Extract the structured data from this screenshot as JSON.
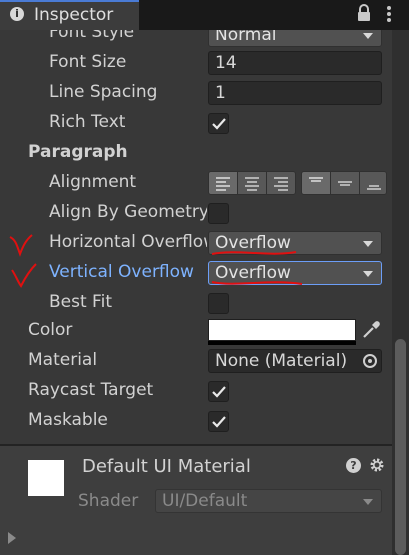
{
  "window": {
    "tab_title": "Inspector"
  },
  "properties": {
    "font_style": {
      "label": "Font Style",
      "value": "Normal"
    },
    "font_size": {
      "label": "Font Size",
      "value": "14"
    },
    "line_spacing": {
      "label": "Line Spacing",
      "value": "1"
    },
    "rich_text": {
      "label": "Rich Text",
      "checked": true
    },
    "paragraph_header": "Paragraph",
    "alignment": {
      "label": "Alignment",
      "horizontal_selected": "left",
      "vertical_selected": "top"
    },
    "align_by_geometry": {
      "label": "Align By Geometry",
      "checked": false
    },
    "horizontal_overflow": {
      "label": "Horizontal Overflow",
      "value": "Overflow"
    },
    "vertical_overflow": {
      "label": "Vertical Overflow",
      "value": "Overflow"
    },
    "best_fit": {
      "label": "Best Fit",
      "checked": false
    },
    "color": {
      "label": "Color",
      "value": "#ffffff"
    },
    "material": {
      "label": "Material",
      "value": "None (Material)"
    },
    "raycast_target": {
      "label": "Raycast Target",
      "checked": true
    },
    "maskable": {
      "label": "Maskable",
      "checked": true
    }
  },
  "material_section": {
    "name": "Default UI Material",
    "shader_label": "Shader",
    "shader_value": "UI/Default",
    "help_glyph": "?"
  },
  "annotations": {
    "color": "#e01010",
    "marks": [
      "checkmark-horizontal-overflow",
      "checkmark-vertical-overflow",
      "underline-overflow-values"
    ]
  },
  "icons": [
    "info-icon",
    "lock-icon",
    "more-options-icon",
    "eyedropper-icon",
    "object-picker-icon",
    "help-icon",
    "gear-icon"
  ]
}
